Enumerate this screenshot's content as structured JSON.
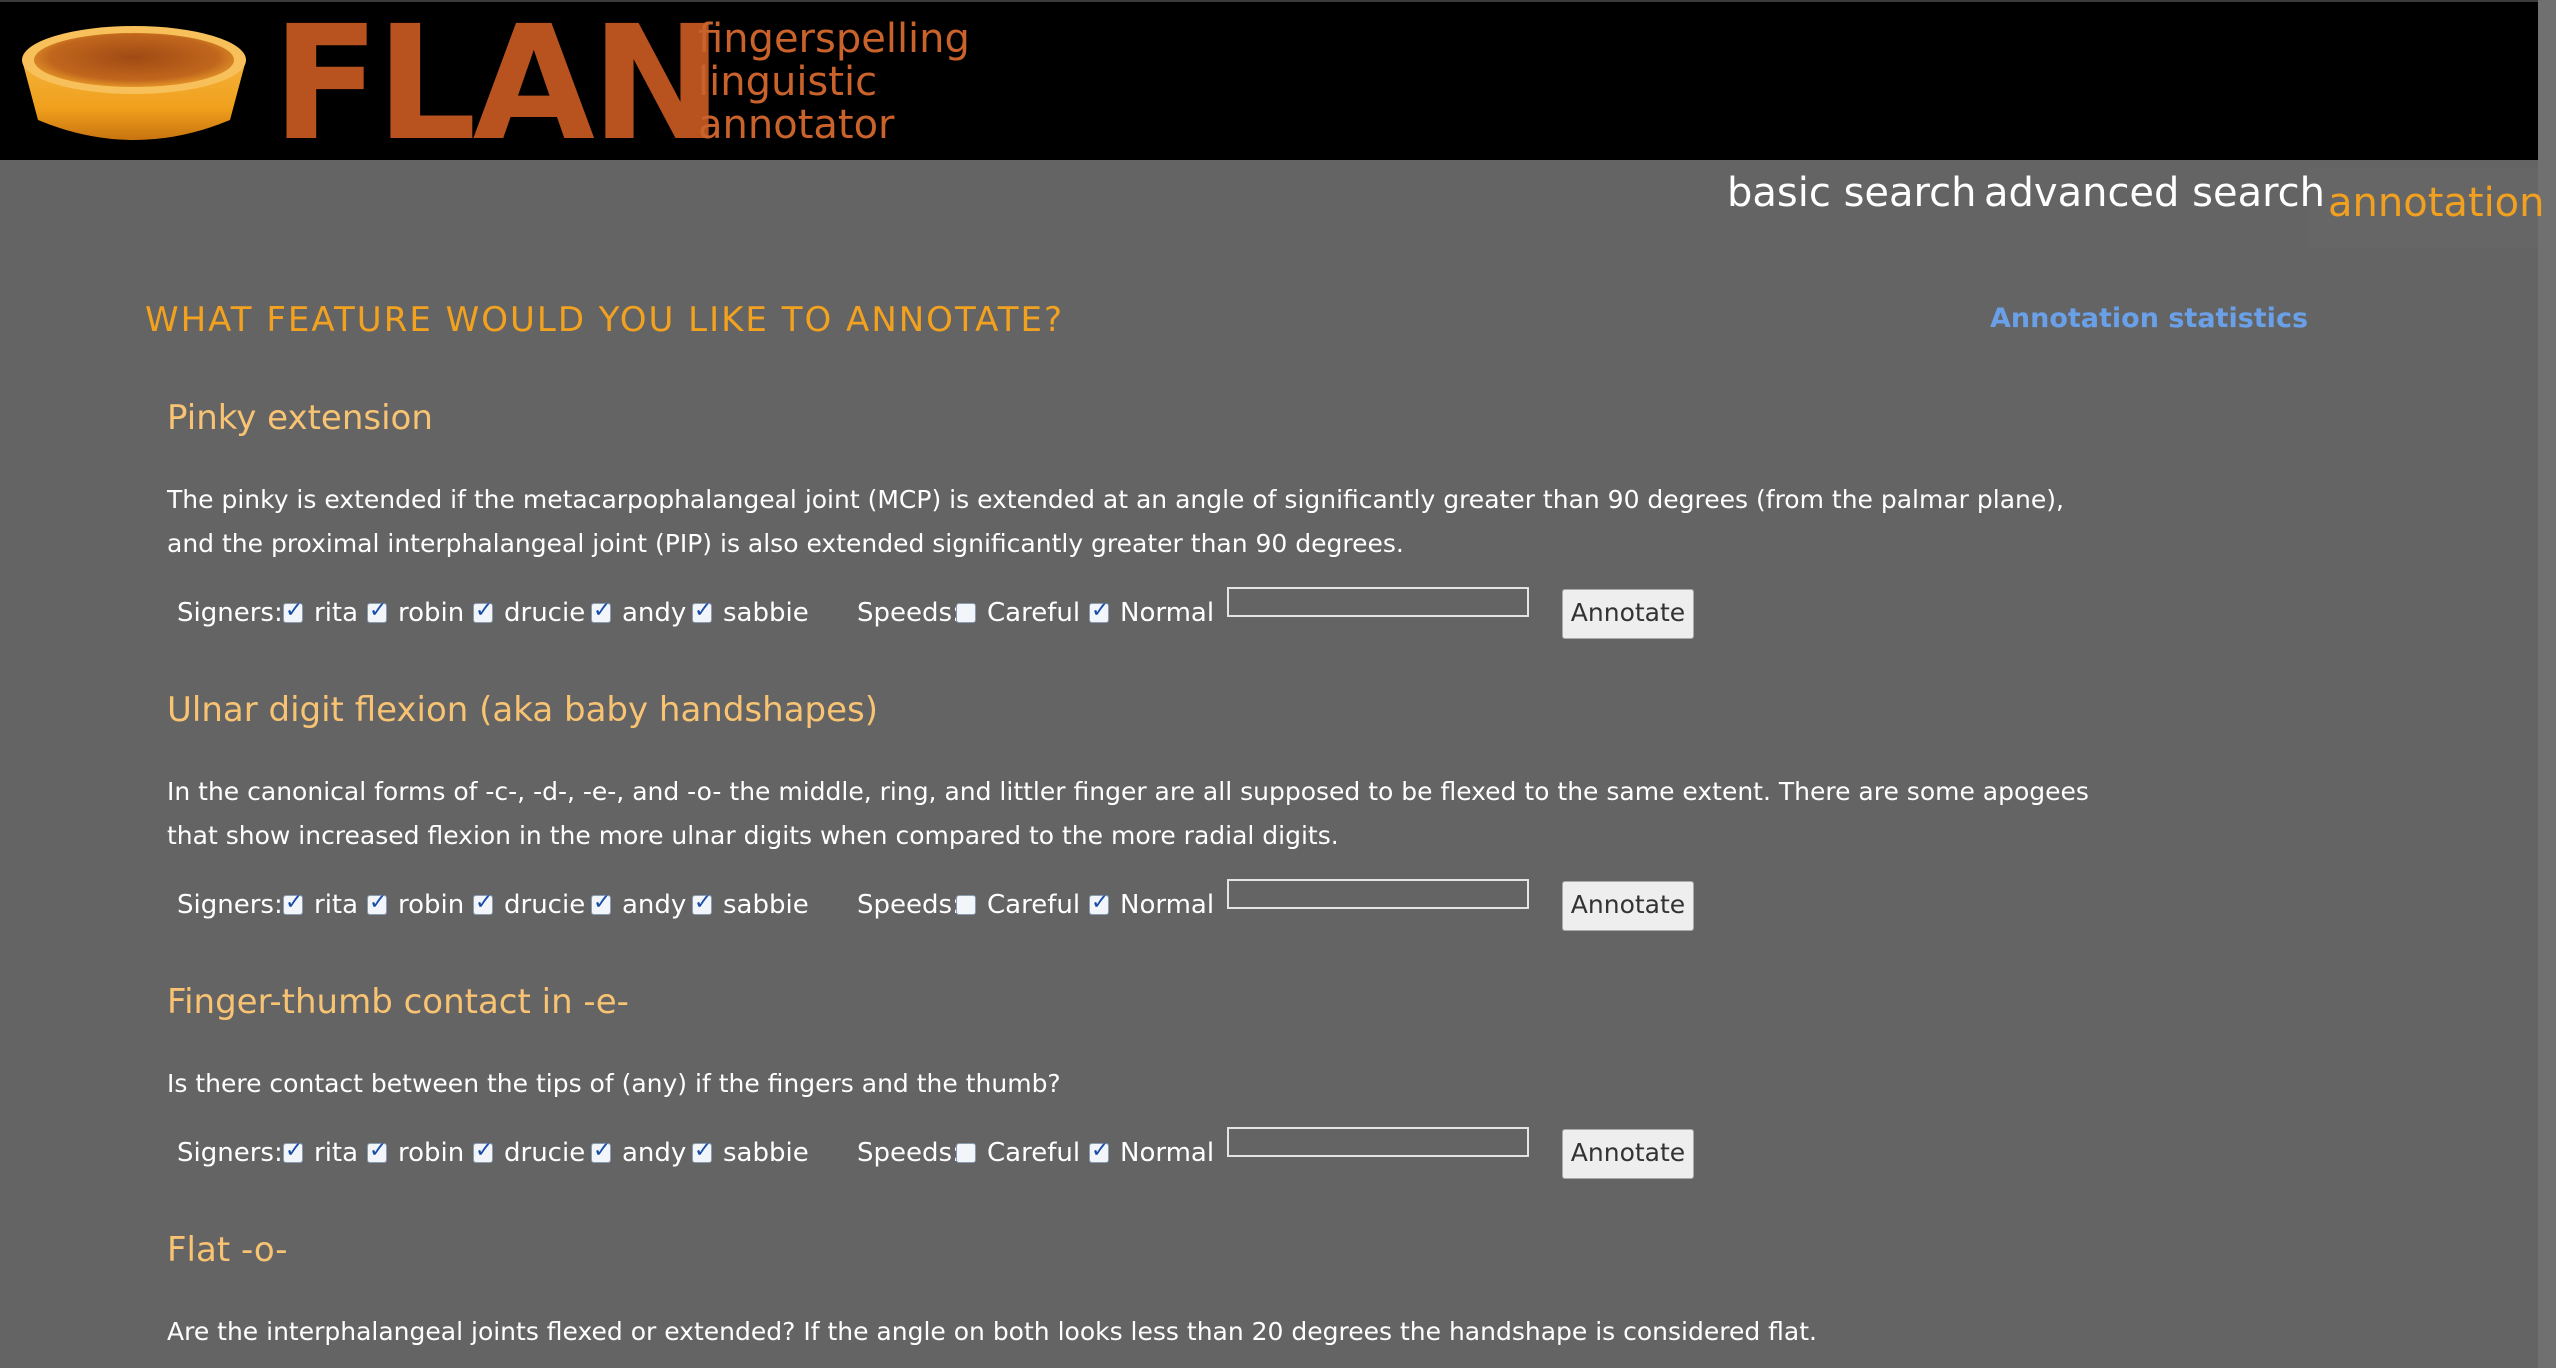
{
  "header": {
    "logo_text": "FLAN",
    "tagline": [
      "fingerspelling",
      "linguistic",
      "annotator"
    ]
  },
  "nav": {
    "items": [
      {
        "label": "basic search",
        "active": false
      },
      {
        "label": "advanced search",
        "active": false
      },
      {
        "label": "annotation",
        "active": true
      }
    ]
  },
  "main": {
    "title": "WHAT FEATURE WOULD YOU LIKE TO ANNOTATE?",
    "stats_link": "Annotation statistics",
    "features": [
      {
        "title": "Pinky extension",
        "description": "The pinky is extended if the metacarpophalangeal joint (MCP) is extended at an angle of significantly greater than 90 degrees (from the palmar plane), and the proximal interphalangeal joint (PIP) is also extended significantly greater than 90 degrees.",
        "signers_label": "Signers:",
        "signers": [
          {
            "name": "rita",
            "checked": true
          },
          {
            "name": "robin",
            "checked": true
          },
          {
            "name": "drucie",
            "checked": true
          },
          {
            "name": "andy",
            "checked": true
          },
          {
            "name": "sabbie",
            "checked": true
          }
        ],
        "speeds_label": "Speeds:",
        "speeds": [
          {
            "name": "Careful",
            "checked": false
          },
          {
            "name": "Normal",
            "checked": true
          }
        ],
        "input_value": "",
        "button_label": "Annotate"
      },
      {
        "title": "Ulnar digit flexion (aka baby handshapes)",
        "description": "In the canonical forms of -c-, -d-, -e-, and -o- the middle, ring, and littler finger are all supposed to be flexed to the same extent. There are some apogees that show increased flexion in the more ulnar digits when compared to the more radial digits.",
        "signers_label": "Signers:",
        "signers": [
          {
            "name": "rita",
            "checked": true
          },
          {
            "name": "robin",
            "checked": true
          },
          {
            "name": "drucie",
            "checked": true
          },
          {
            "name": "andy",
            "checked": true
          },
          {
            "name": "sabbie",
            "checked": true
          }
        ],
        "speeds_label": "Speeds:",
        "speeds": [
          {
            "name": "Careful",
            "checked": false
          },
          {
            "name": "Normal",
            "checked": true
          }
        ],
        "input_value": "",
        "button_label": "Annotate"
      },
      {
        "title": "Finger-thumb contact in -e-",
        "description": "Is there contact between the tips of (any) if the fingers and the thumb?",
        "signers_label": "Signers:",
        "signers": [
          {
            "name": "rita",
            "checked": true
          },
          {
            "name": "robin",
            "checked": true
          },
          {
            "name": "drucie",
            "checked": true
          },
          {
            "name": "andy",
            "checked": true
          },
          {
            "name": "sabbie",
            "checked": true
          }
        ],
        "speeds_label": "Speeds:",
        "speeds": [
          {
            "name": "Careful",
            "checked": false
          },
          {
            "name": "Normal",
            "checked": true
          }
        ],
        "input_value": "",
        "button_label": "Annotate"
      },
      {
        "title": "Flat -o-",
        "description": "Are the interphalangeal joints flexed or extended? If the angle on both looks less than 20 degrees the handshape is considered flat."
      }
    ]
  }
}
